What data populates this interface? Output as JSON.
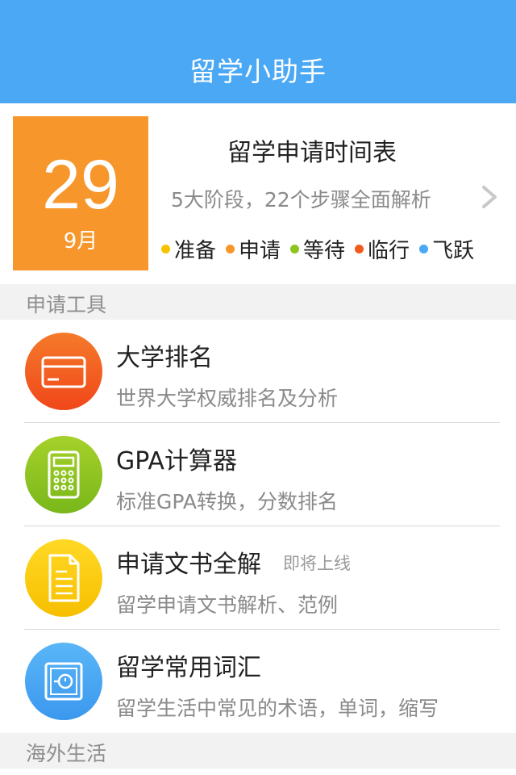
{
  "header": {
    "title": "留学小助手"
  },
  "timeline": {
    "day": "29",
    "month": "9月",
    "title": "留学申请时间表",
    "subtitle": "5大阶段，22个步骤全面解析",
    "stages": [
      {
        "label": "准备",
        "color": "#f6c400"
      },
      {
        "label": "申请",
        "color": "#f7962b"
      },
      {
        "label": "等待",
        "color": "#8cc51f"
      },
      {
        "label": "临行",
        "color": "#f25a1d"
      },
      {
        "label": "飞跃",
        "color": "#4aa8f4"
      }
    ]
  },
  "sections": {
    "tools": "申请工具",
    "life": "海外生活"
  },
  "tools": [
    {
      "name": "大学排名",
      "desc": "世界大学权威排名及分析",
      "icon": "card-icon",
      "color": "#f25a1d"
    },
    {
      "name": "GPA计算器",
      "desc": "标准GPA转换，分数排名",
      "icon": "calculator-icon",
      "color": "#8cc51f"
    },
    {
      "name": "申请文书全解",
      "tag": "即将上线",
      "desc": "留学申请文书解析、范例",
      "icon": "document-icon",
      "color": "#f6c400"
    },
    {
      "name": "留学常用词汇",
      "desc": "留学生活中常见的术语，单词，缩写",
      "icon": "safe-icon",
      "color": "#4aa8f4"
    }
  ]
}
